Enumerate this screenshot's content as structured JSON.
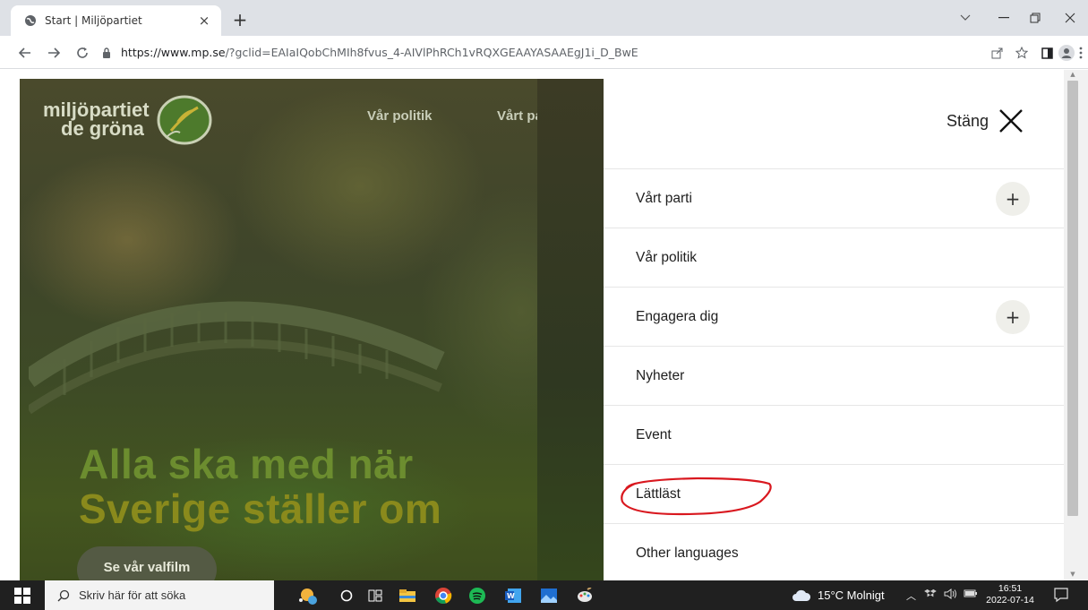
{
  "browser": {
    "tab_title": "Start | Miljöpartiet",
    "tab_close": "×",
    "new_tab": "+",
    "url_host": "https://www.mp.se",
    "url_rest": "/?gclid=EAIaIQobChMIh8fvus_4-AIVlPhRCh1vRQXGEAAYASAAEgJ1i_D_BwE"
  },
  "site": {
    "logo_line1": "miljöpartiet",
    "logo_line2": "de gröna",
    "nav": [
      "Vår politik",
      "Vårt parti"
    ],
    "headline_line1": "Alla ska med när",
    "headline_line2": "Sverige ställer om",
    "cta_label": "Se vår valfilm"
  },
  "drawer": {
    "close_label": "Stäng",
    "items": [
      {
        "label": "Vårt parti",
        "expandable": true
      },
      {
        "label": "Vår politik",
        "expandable": false
      },
      {
        "label": "Engagera dig",
        "expandable": true
      },
      {
        "label": "Nyheter",
        "expandable": false
      },
      {
        "label": "Event",
        "expandable": false
      },
      {
        "label": "Lättläst",
        "expandable": false,
        "annotated": true
      },
      {
        "label": "Other languages",
        "expandable": false
      }
    ],
    "plus_symbol": "+",
    "annotation_color": "#d9181f"
  },
  "taskbar": {
    "search_placeholder": "Skriv här för att söka",
    "weather": "15°C Molnigt",
    "time": "16:51",
    "date": "2022-07-14"
  },
  "colors": {
    "brand_green": "#6c8d2f",
    "brand_olive": "#8a8a1c",
    "chrome_bg": "#dee1e6",
    "taskbar_bg": "#202020"
  }
}
